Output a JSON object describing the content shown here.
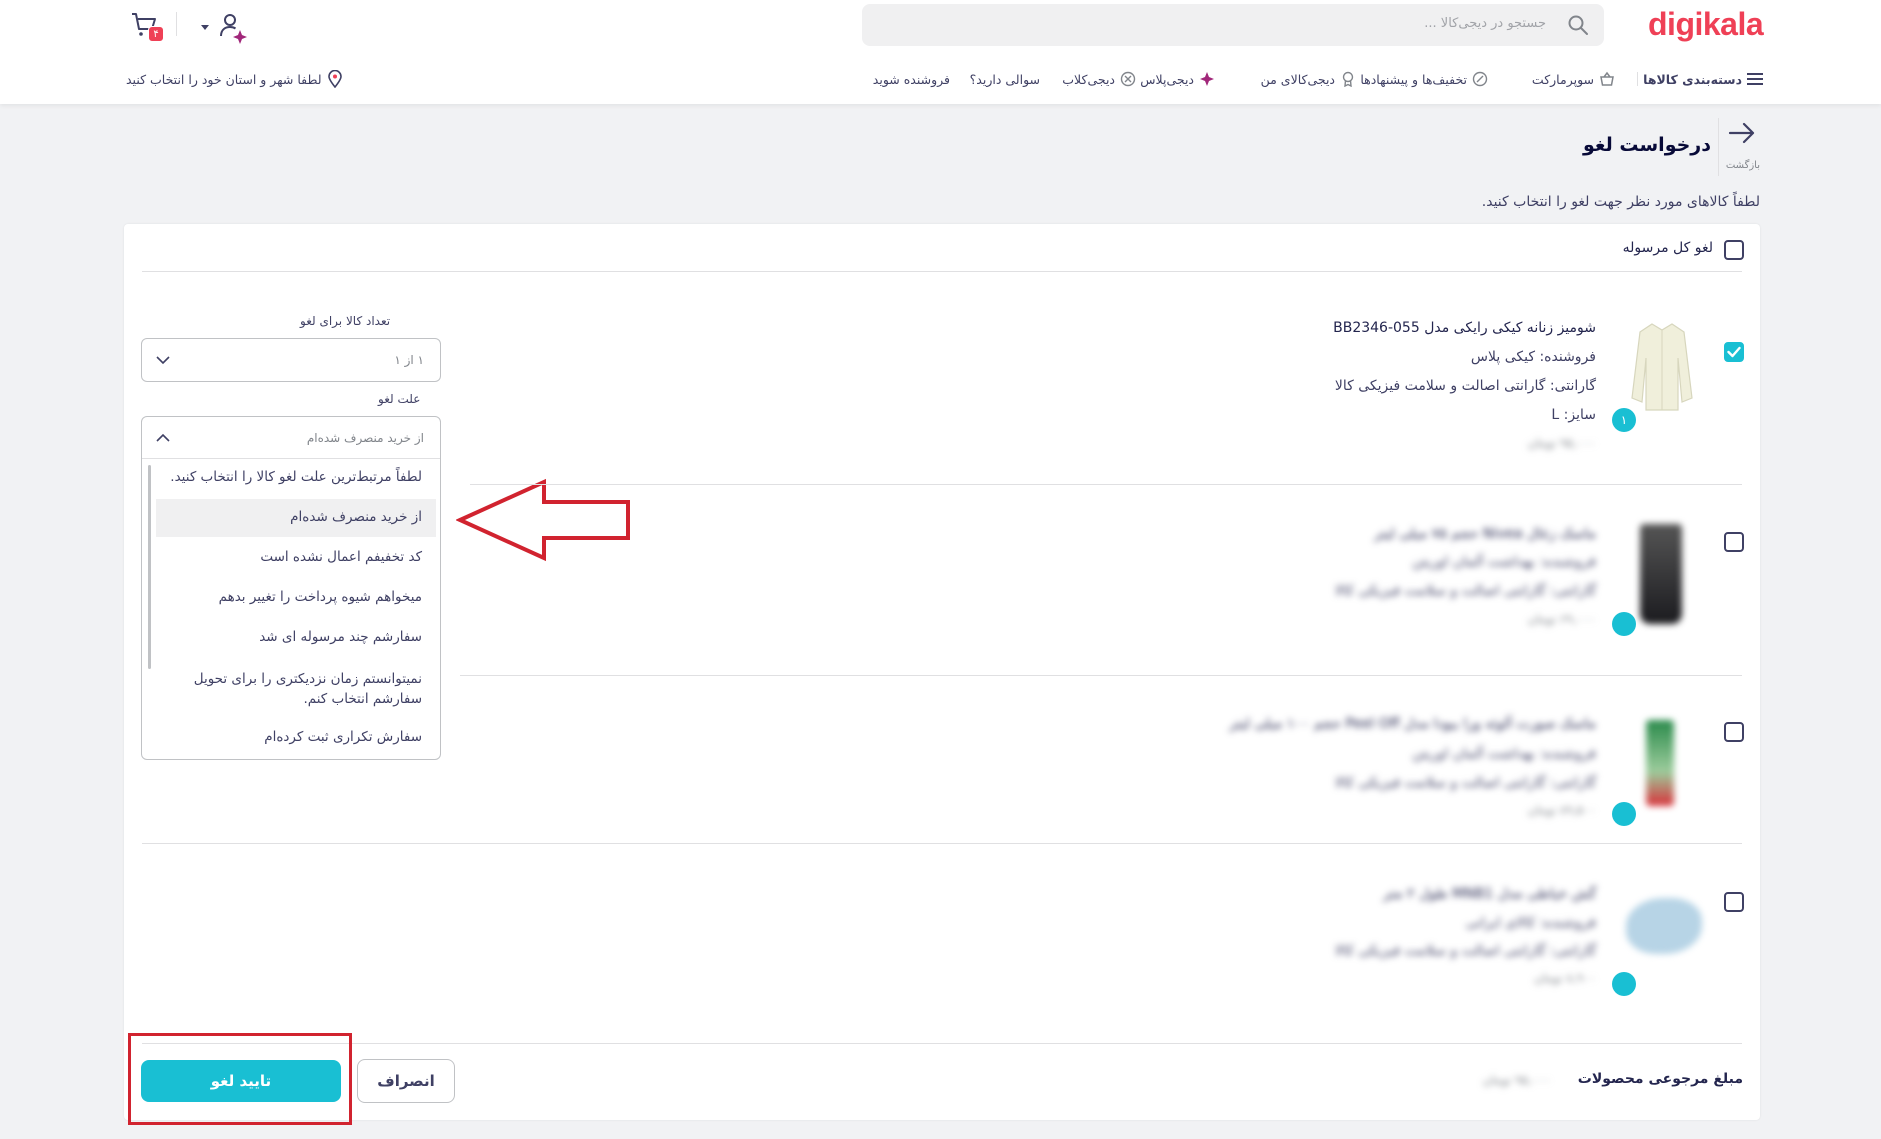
{
  "header": {
    "logo": "digikala",
    "search_placeholder": "جستجو در دیجی‌کالا ...",
    "cart_badge": "۴",
    "location_text": "لطفا شهر و استان خود را انتخاب کنید",
    "nav": {
      "categories": "دسته‌بندی کالاها",
      "supermarket": "سوپرمارکت",
      "offers": "تخفیف‌ها و پیشنهادها",
      "my_digikala": "دیجی‌کالای من",
      "digiplus": "دیجی‌پلاس",
      "digiclub": "دیجی‌کلاب",
      "questions": "سوالی دارید؟",
      "become_seller": "فروشنده شوید"
    }
  },
  "page": {
    "back_label": "بازگشت",
    "title": "درخواست لغو",
    "instruction": "لطفاً کالاهای مورد نظر جهت لغو را انتخاب کنید.",
    "cancel_all_label": "لغو کل مرسوله"
  },
  "items": [
    {
      "name": "شومیز زنانه کیکی رایکی مدل BB2346-055",
      "seller": "فروشنده: کیکی پلاس",
      "warranty": "گارانتی: گارانتی اصالت و سلامت فیزیکی کالا",
      "size": "سایز: L",
      "price": "۹۵,۰۰۰ تومان",
      "qty_badge": "۱",
      "checked": true
    },
    {
      "name": "ماسک زغال Nivea حجم ۷۵ میلی لیتر",
      "seller": "فروشنده: بهداشت آلمان اوریتن",
      "warranty": "گارانتی: گارانتی اصالت و سلامت فیزیکی کالا",
      "price": "۶۹,۰۰۰ تومان",
      "qty_badge": "۱",
      "checked": false
    },
    {
      "name": "ماسک صورت آلوئه ورا بیودا مدل Peel Off حجم ۱۰۰ میلی لیتر",
      "seller": "فروشنده: بهداشت آلمان اوریتن",
      "warranty": "گارانتی: گارانتی اصالت و سلامت فیزیکی کالا",
      "price": "۸۹,۵۰۰ تومان",
      "qty_badge": "۱",
      "checked": false
    },
    {
      "name": "گش خیاطی مدل MNB1 طول ۲ متر",
      "seller": "فروشنده: کالای ایرانی",
      "warranty": "گارانتی: گارانتی اصالت و سلامت فیزیکی کالا",
      "price": "۸,۹۰۰ تومان",
      "qty_badge": "۱",
      "checked": false
    }
  ],
  "cancel_form": {
    "qty_label": "تعداد کالا برای لغو",
    "qty_value": "۱ از ۱",
    "reason_label": "علت لغو",
    "reason_value": "از خرید منصرف شده‌ام",
    "reason_options": [
      "لطفاً مرتبط‌ترین علت لغو کالا را انتخاب کنید.",
      "از خرید منصرف شده‌ام",
      "کد تخفیفم اعمال نشده است",
      "میخواهم شیوه پرداخت را تغییر بدهم",
      "سفارشم چند مرسوله ای شد",
      "نمیتوانستم زمان نزدیکتری را برای تحویل سفارشم انتخاب کنم.",
      "سفارش تکراری ثبت کرده‌ام"
    ],
    "highlighted_option": "از خرید منصرف شده‌ام"
  },
  "footer": {
    "refund_label": "مبلغ مرجوعی محصولات",
    "refund_value": "۹۵,۰۰۰ تومان",
    "cancel_button": "انصراف",
    "confirm_button": "تایید لغو"
  },
  "colors": {
    "brand": "#ef4056",
    "accent": "#19bfd3",
    "annotation": "#d1232f"
  }
}
